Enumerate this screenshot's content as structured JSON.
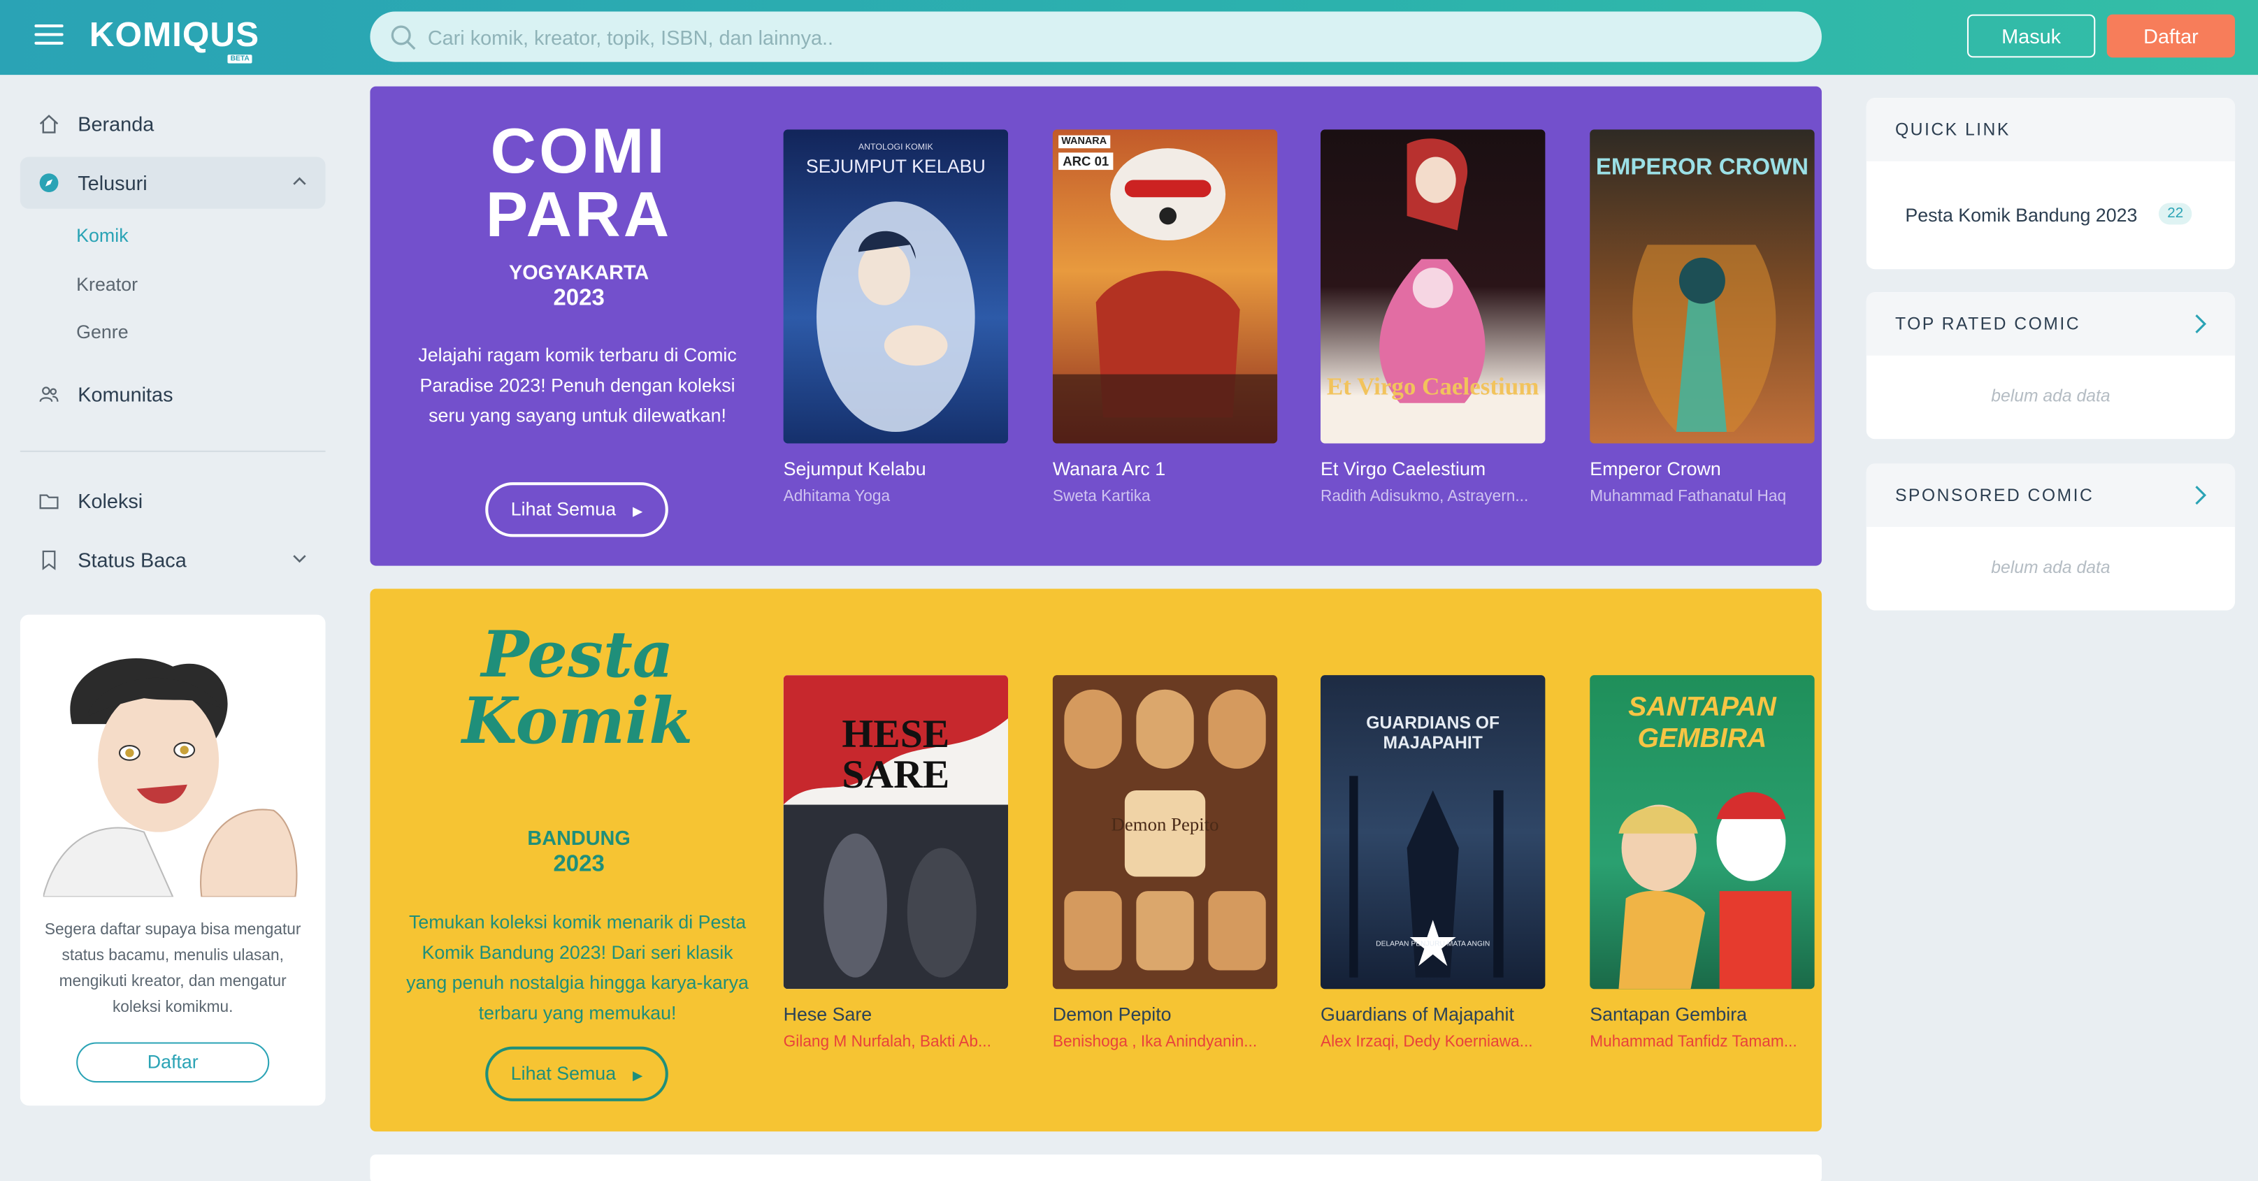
{
  "header": {
    "logo": "KOMIQUS",
    "logo_badge": "BETA",
    "search_placeholder": "Cari komik, kreator, topik, ISBN, dan lainnya..",
    "login_label": "Masuk",
    "register_label": "Daftar"
  },
  "sidebar": {
    "items": [
      {
        "label": "Beranda",
        "icon": "home-icon"
      },
      {
        "label": "Telusuri",
        "icon": "compass-icon"
      },
      {
        "label": "Komunitas",
        "icon": "users-icon"
      },
      {
        "label": "Koleksi",
        "icon": "folder-icon"
      },
      {
        "label": "Status Baca",
        "icon": "bookmark-icon"
      }
    ],
    "sub_items": [
      "Komik",
      "Kreator",
      "Genre"
    ],
    "promo": {
      "text": "Segera daftar supaya bisa mengatur status bacamu, menulis ulasan, mengikuti kreator, dan mengatur koleksi komikmu.",
      "button": "Daftar"
    }
  },
  "sections": [
    {
      "brand_line1": "COMI",
      "brand_line2": "PARA",
      "brand_city": "YOGYAKARTA",
      "brand_year": "2023",
      "description": "Jelajahi ragam komik terbaru di Comic Paradise 2023! Penuh dengan koleksi seru yang sayang untuk dilewatkan!",
      "button": "Lihat Semua",
      "comics": [
        {
          "title": "Sejumput Kelabu",
          "author": "Adhitama Yoga",
          "cover_text": "SEJUMPUT KELABU",
          "cover_sub": "ANTOLOGI KOMIK"
        },
        {
          "title": "Wanara Arc 1",
          "author": "Sweta Kartika",
          "cover_text": "WANARA",
          "cover_sub": "ARC 01"
        },
        {
          "title": "Et Virgo Caelestium",
          "author": "Radith Adisukmo, Astrayern...",
          "cover_text": "Et Virgo Caelestium",
          "cover_sub": ""
        },
        {
          "title": "Emperor Crown",
          "author": "Muhammad Fathanatul Haq",
          "cover_text": "EMPEROR CROWN",
          "cover_sub": ""
        }
      ]
    },
    {
      "brand_line1": "Pesta",
      "brand_line2": "Komik",
      "brand_city": "BANDUNG",
      "brand_year": "2023",
      "description": "Temukan koleksi komik menarik di Pesta Komik Bandung 2023! Dari seri klasik yang penuh nostalgia hingga karya-karya terbaru yang memukau!",
      "button": "Lihat Semua",
      "comics": [
        {
          "title": "Hese Sare",
          "author": "Gilang M Nurfalah, Bakti Ab...",
          "cover_text": "HESE SARE",
          "cover_sub": ""
        },
        {
          "title": "Demon Pepito",
          "author": "Benishoga , Ika Anindyanin...",
          "cover_text": "Demon Pepito",
          "cover_sub": ""
        },
        {
          "title": "Guardians of Majapahit",
          "author": "Alex Irzaqi, Dedy Koerniawa...",
          "cover_text": "GUARDIANS OF MAJAPAHIT",
          "cover_sub": "DELAPAN PENJURU MATA ANGIN"
        },
        {
          "title": "Santapan Gembira",
          "author": "Muhammad Tanfidz Tamam...",
          "cover_text": "SANTAPAN GEMBIRA",
          "cover_sub": ""
        }
      ]
    }
  ],
  "right_panel": {
    "quick_link": {
      "heading": "QUICK LINK",
      "item": "Pesta Komik Bandung 2023",
      "count": "22"
    },
    "top_rated": {
      "heading": "TOP RATED COMIC",
      "empty": "belum ada data"
    },
    "sponsored": {
      "heading": "SPONSORED COMIC",
      "empty": "belum ada data"
    }
  },
  "colors": {
    "accent": "#2aa3b5",
    "register": "#f77d5a",
    "purple_section": "#7350cc",
    "yellow_section": "#f6c433",
    "yellow_text": "#1f8f7a",
    "author_red": "#e8413b"
  }
}
